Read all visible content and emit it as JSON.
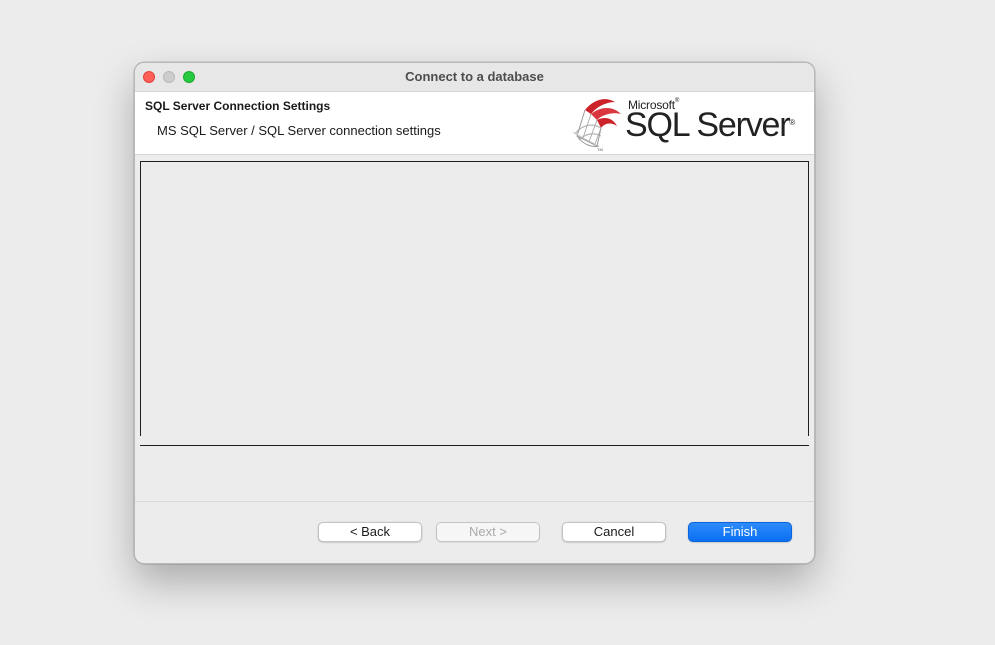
{
  "window": {
    "title": "Connect to a database"
  },
  "header": {
    "title": "SQL Server Connection Settings",
    "subtitle": "MS SQL Server / SQL Server connection settings"
  },
  "logo": {
    "brand": "Microsoft",
    "brand_mark": "®",
    "product": "SQL Server",
    "product_mark": "®",
    "icon": "sql-server-logo-icon"
  },
  "buttons": {
    "back": "< Back",
    "next": "Next >",
    "cancel": "Cancel",
    "finish": "Finish"
  },
  "colors": {
    "accent": "#0a6ff2",
    "close": "#ff5f57",
    "minimize": "#cdcdcd",
    "maximize": "#28c840",
    "logo_red": "#cc2229"
  }
}
